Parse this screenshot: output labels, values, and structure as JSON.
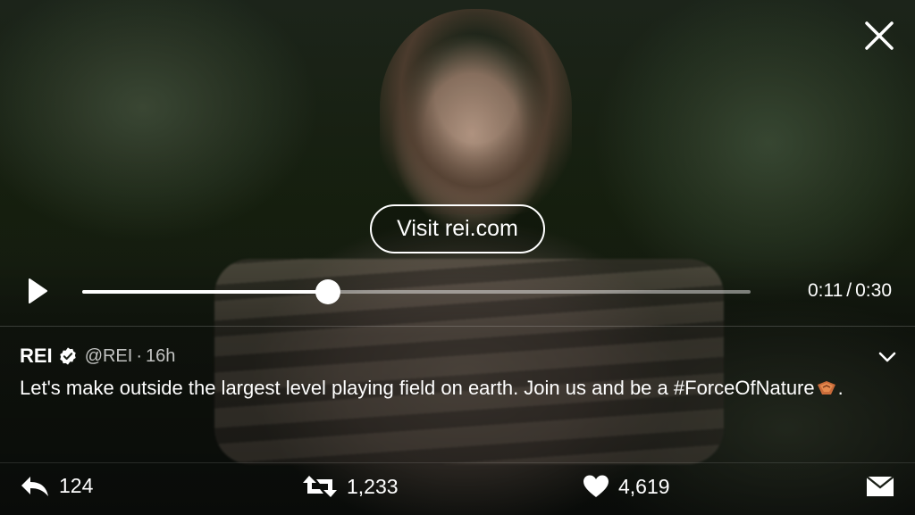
{
  "video": {
    "cta_label": "Visit rei.com",
    "current_time": "0:11",
    "separator": "/",
    "duration": "0:30",
    "progress_fraction": 0.367,
    "state": "paused"
  },
  "tweet": {
    "author": "REI",
    "verified": true,
    "handle": "@REI",
    "dot": "·",
    "age": "16h",
    "text_before": "Let's make outside the largest level playing field on earth. Join us and be a ",
    "hashtag": "#ForceOfNature",
    "text_after": "."
  },
  "actions": {
    "replies": "124",
    "retweets": "1,233",
    "likes": "4,619"
  },
  "icons": {
    "close": "close-icon",
    "play": "play-icon",
    "verified": "verified-badge-icon",
    "chevron": "chevron-down-icon",
    "reply": "reply-icon",
    "retweet": "retweet-icon",
    "like": "heart-icon",
    "dm": "direct-message-icon",
    "emoji": "rei-emoji-icon"
  },
  "colors": {
    "accent": "#ffffff",
    "verified_badge": "#ffffff",
    "emoji": "#c96b3a"
  }
}
